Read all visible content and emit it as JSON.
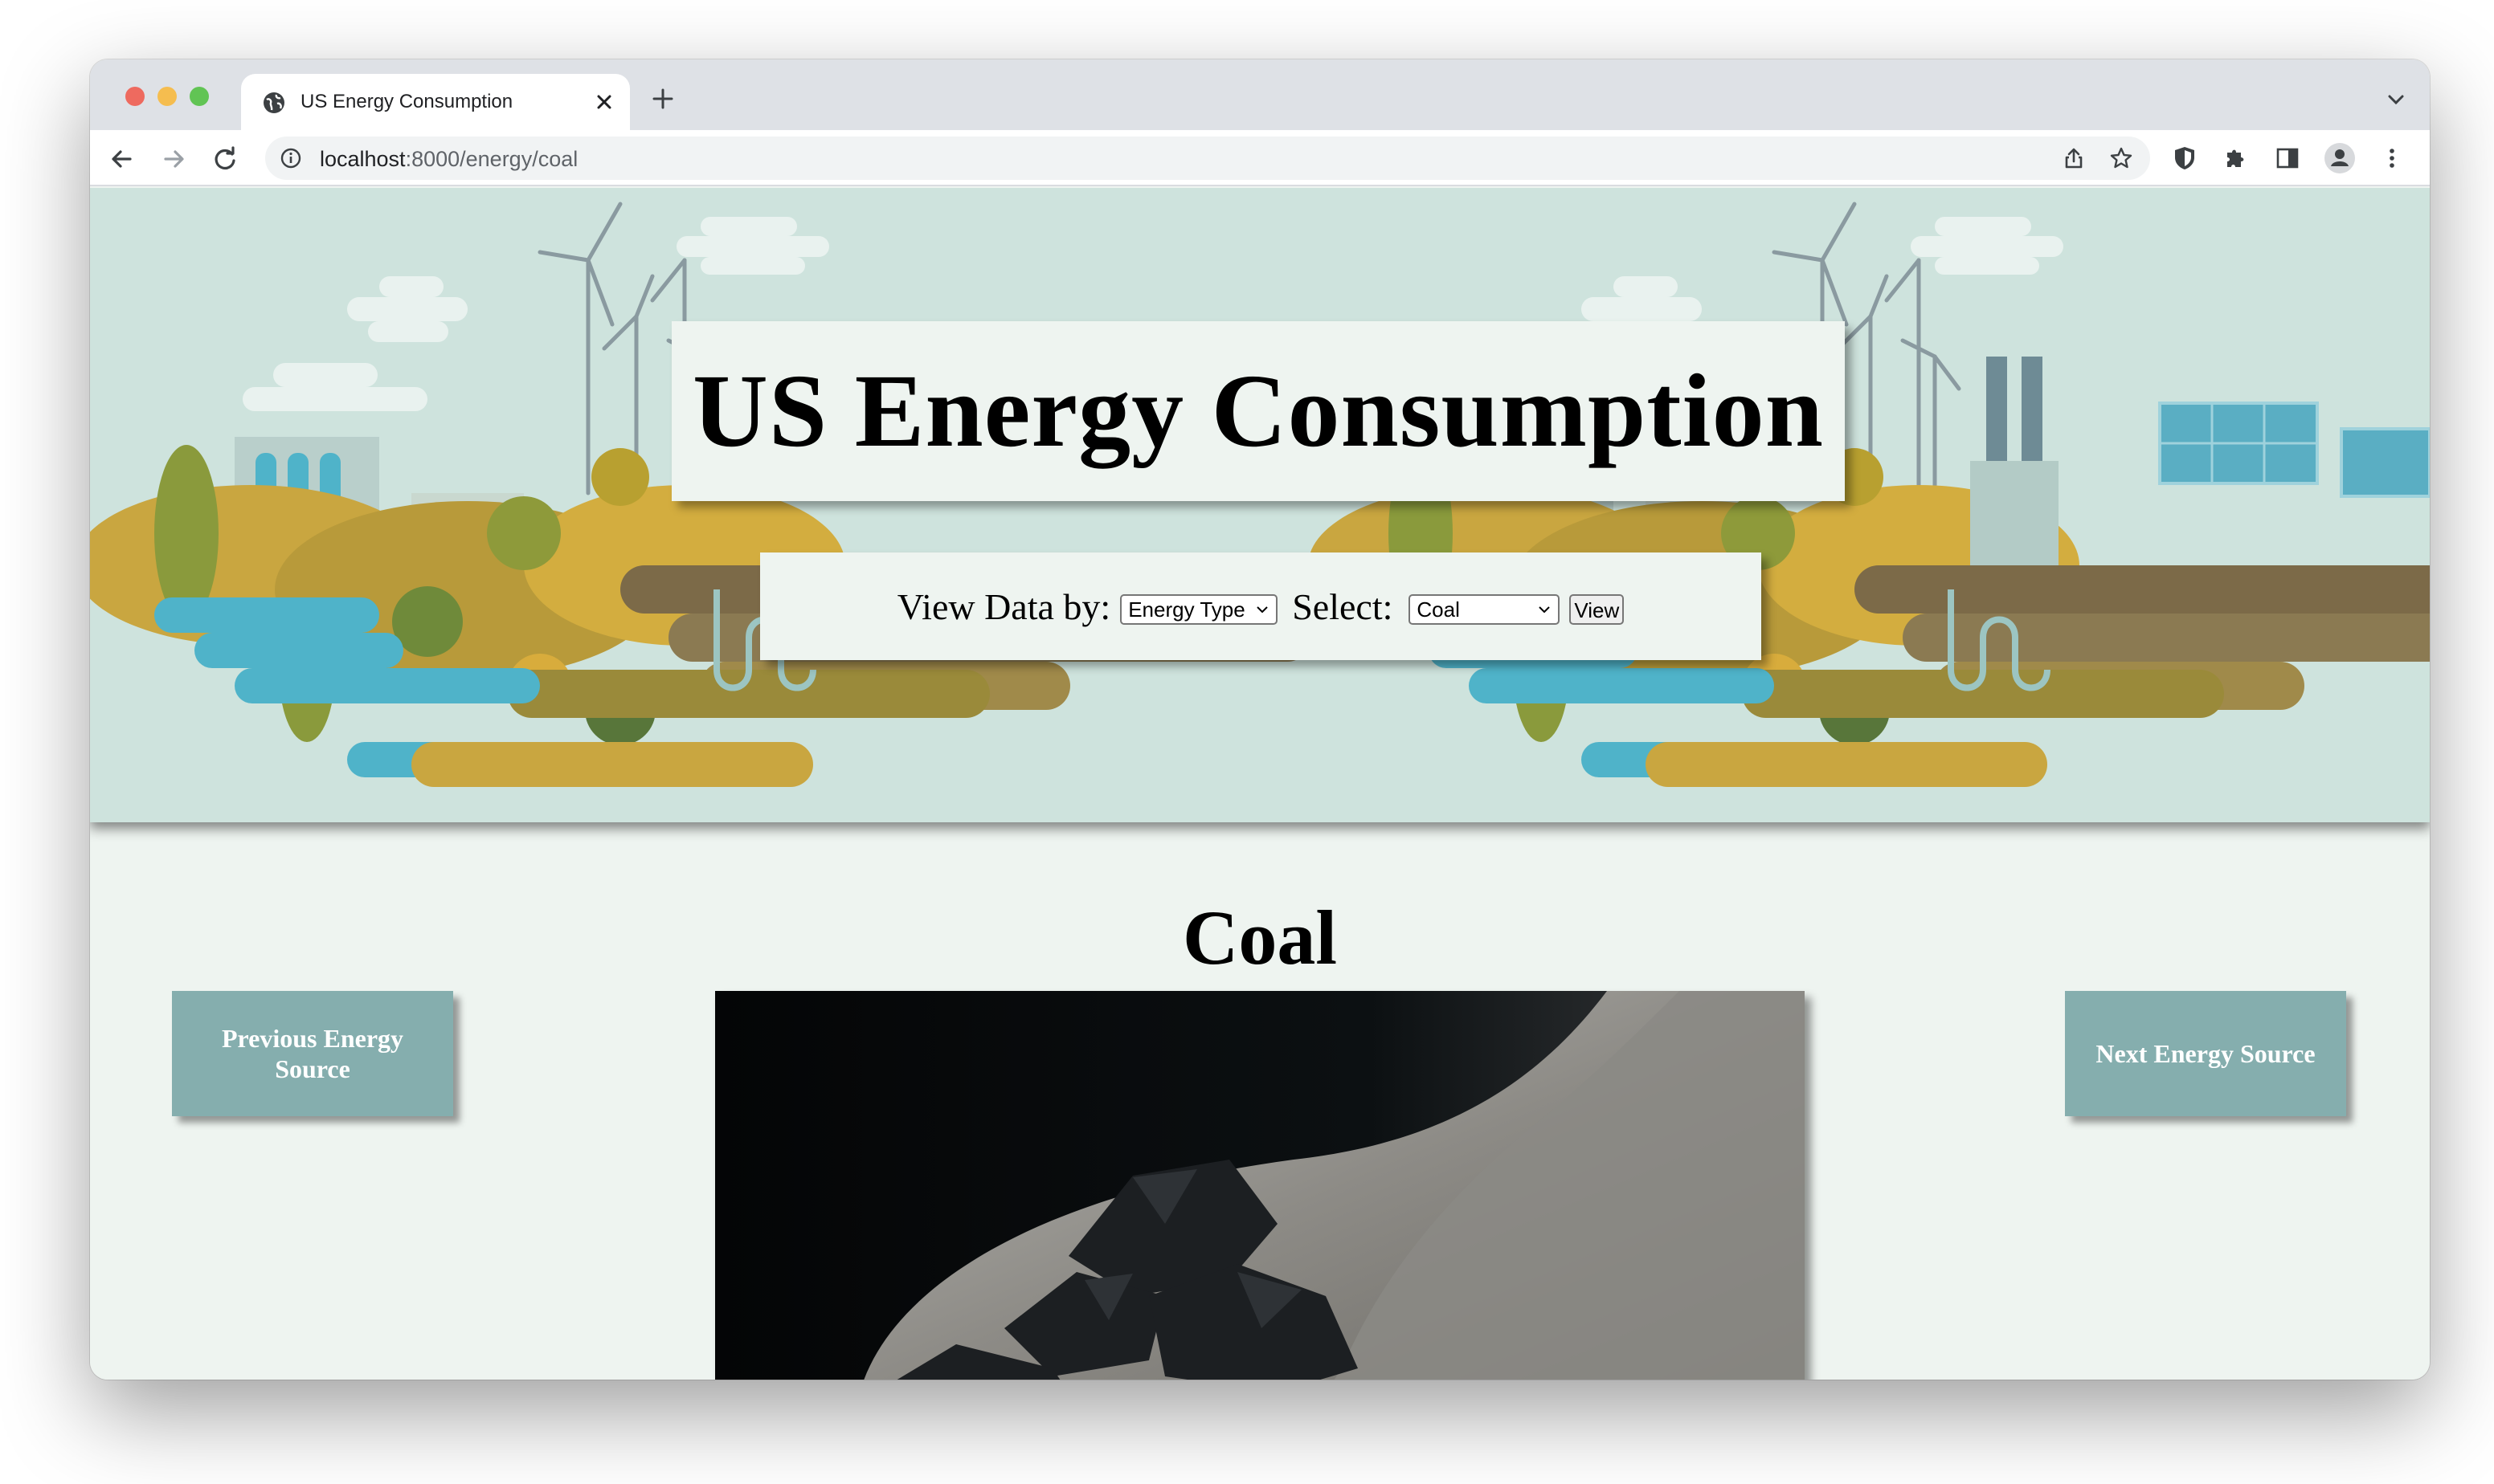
{
  "browser": {
    "tab_title": "US Energy Consumption",
    "url_host": "localhost",
    "url_path": ":8000/energy/coal"
  },
  "page": {
    "title": "US Energy Consumption",
    "view_by_label": "View Data by:",
    "view_by_value": "Energy Type",
    "select_label": "Select:",
    "select_value": "Coal",
    "view_button": "View",
    "source_heading": "Coal",
    "prev_button": "Previous Energy Source",
    "next_button": "Next Energy Source"
  },
  "colors": {
    "banner_bg": "#cee3dd",
    "page_bg": "#eef4f0",
    "nav_button": "#85aeae"
  }
}
